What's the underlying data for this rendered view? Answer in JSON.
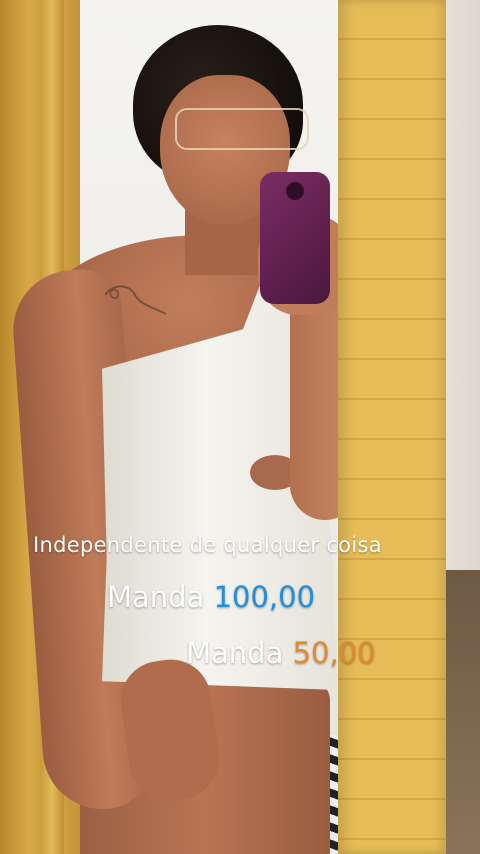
{
  "captions": {
    "line1": "Independente de qualquer coisa",
    "line2_prefix": "Manda",
    "line2_amount": "100,00",
    "line3_prefix": "Manda",
    "line3_amount": "50,00"
  },
  "colors": {
    "amount_100": "#1f8fe0",
    "amount_50": "#e08a30",
    "text": "#ffffff"
  }
}
